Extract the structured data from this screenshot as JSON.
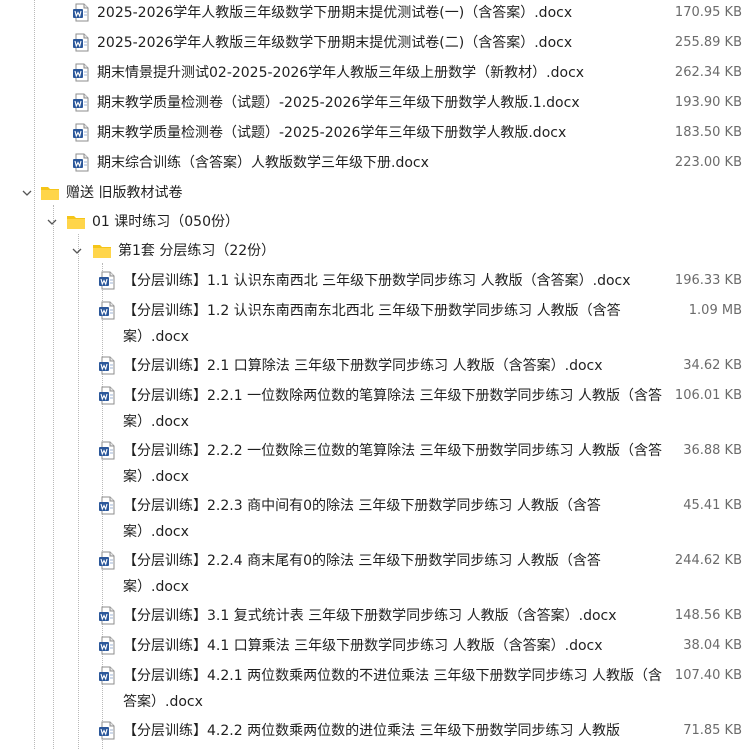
{
  "files_top": [
    {
      "name": "2025-2026学年人教版三年级数学下册期末提优测试卷(一)（含答案）.docx",
      "size": "170.95 KB"
    },
    {
      "name": "2025-2026学年人教版三年级数学下册期末提优测试卷(二)（含答案）.docx",
      "size": "255.89 KB"
    },
    {
      "name": "期末情景提升测试02-2025-2026学年人教版三年级上册数学（新教材）.docx",
      "size": "262.34 KB"
    },
    {
      "name": "期末教学质量检测卷（试题）-2025-2026学年三年级下册数学人教版.1.docx",
      "size": "193.90 KB"
    },
    {
      "name": "期末教学质量检测卷（试题）-2025-2026学年三年级下册数学人教版.docx",
      "size": "183.50 KB"
    },
    {
      "name": "期末综合训练（含答案）人教版数学三年级下册.docx",
      "size": "223.00 KB"
    }
  ],
  "folder_1": {
    "name": "赠送 旧版教材试卷"
  },
  "folder_2": {
    "name": "01 课时练习（050份）"
  },
  "folder_3": {
    "name": "第1套 分层练习（22份）"
  },
  "files_sub": [
    {
      "name": "【分层训练】1.1 认识东南西北 三年级下册数学同步练习 人教版（含答案）.docx",
      "size": "196.33 KB"
    },
    {
      "name": "【分层训练】1.2 认识东南西南东北西北 三年级下册数学同步练习 人教版（含答案）.docx",
      "size": "1.09 MB"
    },
    {
      "name": "【分层训练】2.1 口算除法 三年级下册数学同步练习 人教版（含答案）.docx",
      "size": "34.62 KB"
    },
    {
      "name": "【分层训练】2.2.1 一位数除两位数的笔算除法 三年级下册数学同步练习 人教版（含答案）.docx",
      "size": "106.01 KB"
    },
    {
      "name": "【分层训练】2.2.2 一位数除三位数的笔算除法 三年级下册数学同步练习 人教版（含答案）.docx",
      "size": "36.88 KB"
    },
    {
      "name": "【分层训练】2.2.3 商中间有0的除法 三年级下册数学同步练习 人教版（含答案）.docx",
      "size": "45.41 KB"
    },
    {
      "name": "【分层训练】2.2.4 商末尾有0的除法 三年级下册数学同步练习 人教版（含答案）.docx",
      "size": "244.62 KB"
    },
    {
      "name": "【分层训练】3.1 复式统计表 三年级下册数学同步练习 人教版（含答案）.docx",
      "size": "148.56 KB"
    },
    {
      "name": "【分层训练】4.1 口算乘法 三年级下册数学同步练习 人教版（含答案）.docx",
      "size": "38.04 KB"
    },
    {
      "name": "【分层训练】4.2.1 两位数乘两位数的不进位乘法 三年级下册数学同步练习 人教版（含答案）.docx",
      "size": "107.40 KB"
    },
    {
      "name": "【分层训练】4.2.2 两位数乘两位数的进位乘法 三年级下册数学同步练习 人教版",
      "size": "71.85 KB"
    }
  ],
  "colors": {
    "doc_icon_blue": "#2b579a",
    "folder_yellow": "#f5c518",
    "size_gray": "#6b6b6b"
  }
}
